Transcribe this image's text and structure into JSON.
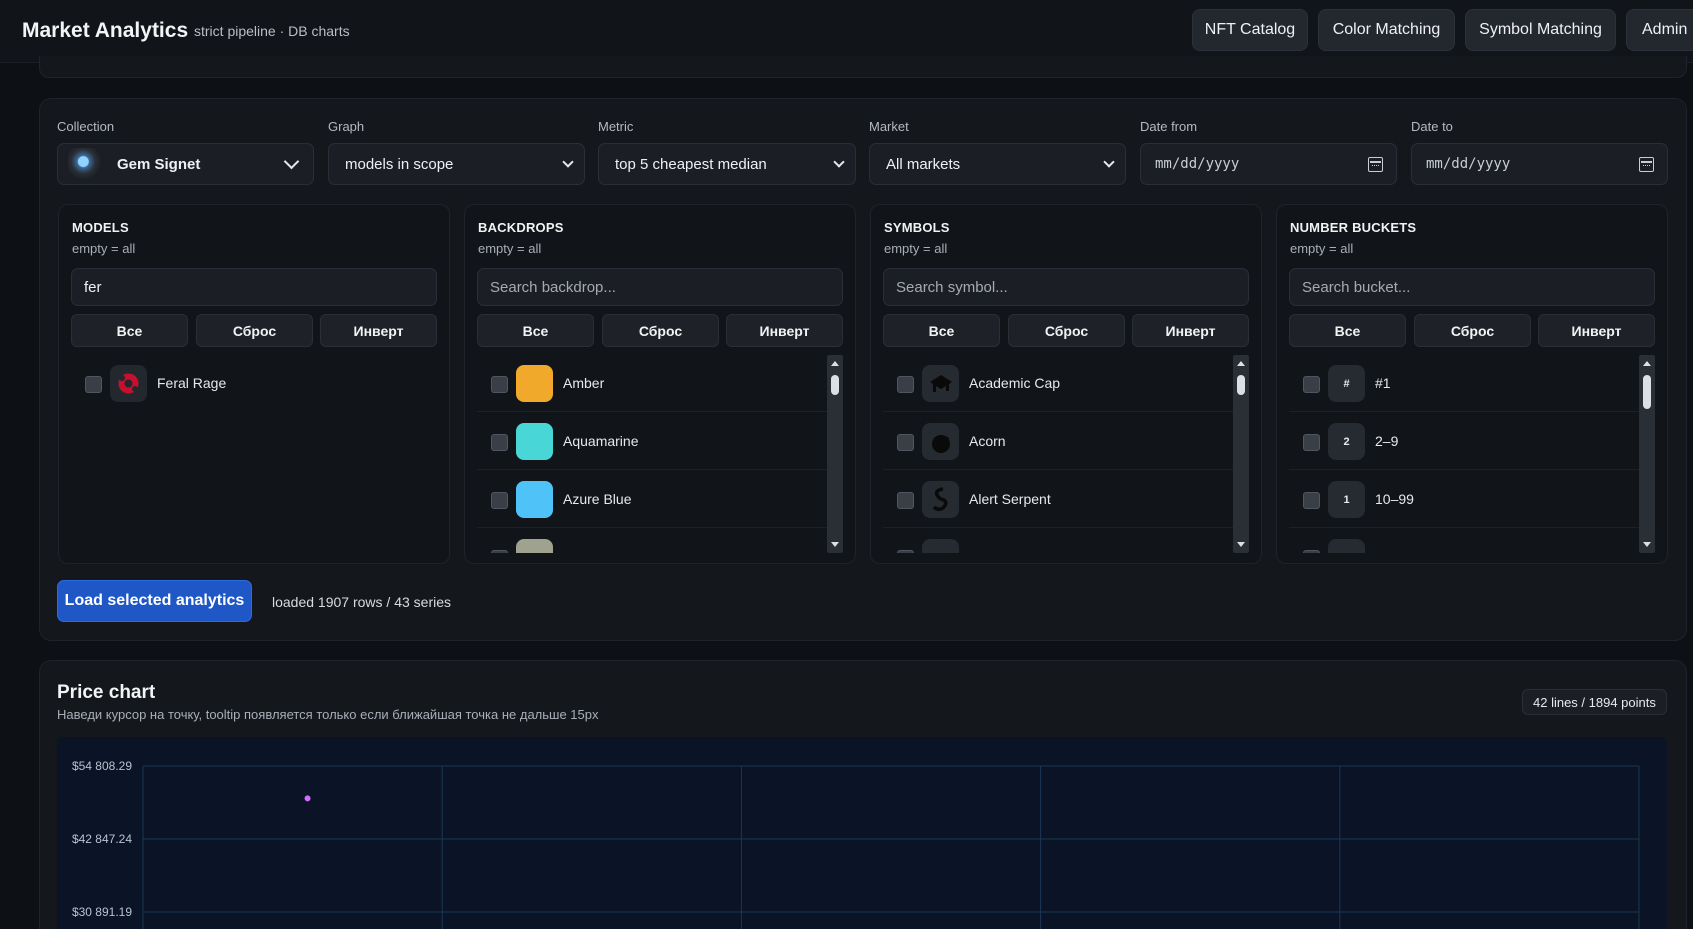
{
  "header": {
    "title": "Market Analytics",
    "subtitle": "strict pipeline · DB charts",
    "nav": [
      "NFT Catalog",
      "Color Matching",
      "Symbol Matching",
      "Admin"
    ]
  },
  "filters": {
    "collection": {
      "label": "Collection",
      "value": "Gem Signet"
    },
    "graph": {
      "label": "Graph",
      "value": "models in scope"
    },
    "metric": {
      "label": "Metric",
      "value": "top 5 cheapest median"
    },
    "market": {
      "label": "Market",
      "value": "All markets"
    },
    "date_from": {
      "label": "Date from",
      "value": "mm/dd/yyyy"
    },
    "date_to": {
      "label": "Date to",
      "value": "mm/dd/yyyy"
    }
  },
  "buttons": {
    "all": "Все",
    "reset": "Сброс",
    "invert": "Инверт"
  },
  "models": {
    "title": "MODELS",
    "sub": "empty = all",
    "search_value": "fer",
    "items": [
      {
        "label": "Feral Rage",
        "icon": "feral-rage-icon"
      }
    ]
  },
  "backdrops": {
    "title": "BACKDROPS",
    "sub": "empty = all",
    "placeholder": "Search backdrop...",
    "items": [
      {
        "label": "Amber",
        "color": "#f0a92a"
      },
      {
        "label": "Aquamarine",
        "color": "#49d6d6"
      },
      {
        "label": "Azure Blue",
        "color": "#4fc3f7"
      }
    ]
  },
  "symbols": {
    "title": "SYMBOLS",
    "sub": "empty = all",
    "placeholder": "Search symbol...",
    "items": [
      {
        "label": "Academic Cap",
        "icon": "academic-cap-icon"
      },
      {
        "label": "Acorn",
        "icon": "acorn-icon"
      },
      {
        "label": "Alert Serpent",
        "icon": "serpent-icon"
      }
    ]
  },
  "buckets": {
    "title": "NUMBER BUCKETS",
    "sub": "empty = all",
    "placeholder": "Search bucket...",
    "items": [
      {
        "badge": "#",
        "label": "#1"
      },
      {
        "badge": "2",
        "label": "2–9"
      },
      {
        "badge": "1",
        "label": "10–99"
      }
    ]
  },
  "load": {
    "button": "Load selected analytics",
    "status": "loaded 1907 rows / 43 series"
  },
  "chart": {
    "title": "Price chart",
    "subtitle": "Наведи курсор на точку, tooltip появляется только если ближайшая точка не дальше 15px",
    "count": "42 lines / 1894 points"
  },
  "chart_data": {
    "type": "scatter",
    "title": "Price chart",
    "y_ticks": [
      "$54 808.29",
      "$42 847.24",
      "$30 891.19"
    ],
    "y_tick_values": [
      54808.29,
      42847.24,
      30891.19
    ],
    "ylim": [
      30891.19,
      54808.29
    ],
    "grid": true,
    "visible_points": [
      {
        "x_fraction_of_range": 0.11,
        "y": 49500,
        "color": "#d36bff"
      }
    ]
  }
}
